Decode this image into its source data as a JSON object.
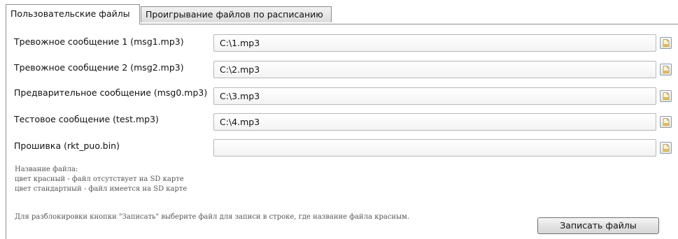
{
  "tabs": [
    {
      "label": "Пользовательские файлы",
      "active": true
    },
    {
      "label": "Проигрывание файлов по расписанию",
      "active": false
    }
  ],
  "rows": [
    {
      "label": "Тревожное сообщение 1 (msg1.mp3)",
      "value": "C:\\1.mp3",
      "icon": "open-file-icon"
    },
    {
      "label": "Тревожное сообщение 2 (msg2.mp3)",
      "value": "C:\\2.mp3",
      "icon": "open-file-icon"
    },
    {
      "label": "Предварительное сообщение (msg0.mp3)",
      "value": "C:\\3.mp3",
      "icon": "open-file-icon"
    },
    {
      "label": "Тестовое сообщение (test.mp3)",
      "value": "C:\\4.mp3",
      "icon": "open-file-icon"
    },
    {
      "label": "Прошивка (rkt_puo.bin)",
      "value": "",
      "icon": "open-file-icon"
    }
  ],
  "legend": {
    "title": "Название файла:",
    "red": "цвет красный - файл отсутствует на SD карте",
    "standard": "цвет стандартный - файл имеется на SD карте"
  },
  "hint": "Для разблокировки кнопки \"Записать\" выберите файл для записи в строке, где название файла красным.",
  "write_button": "Записать файлы"
}
